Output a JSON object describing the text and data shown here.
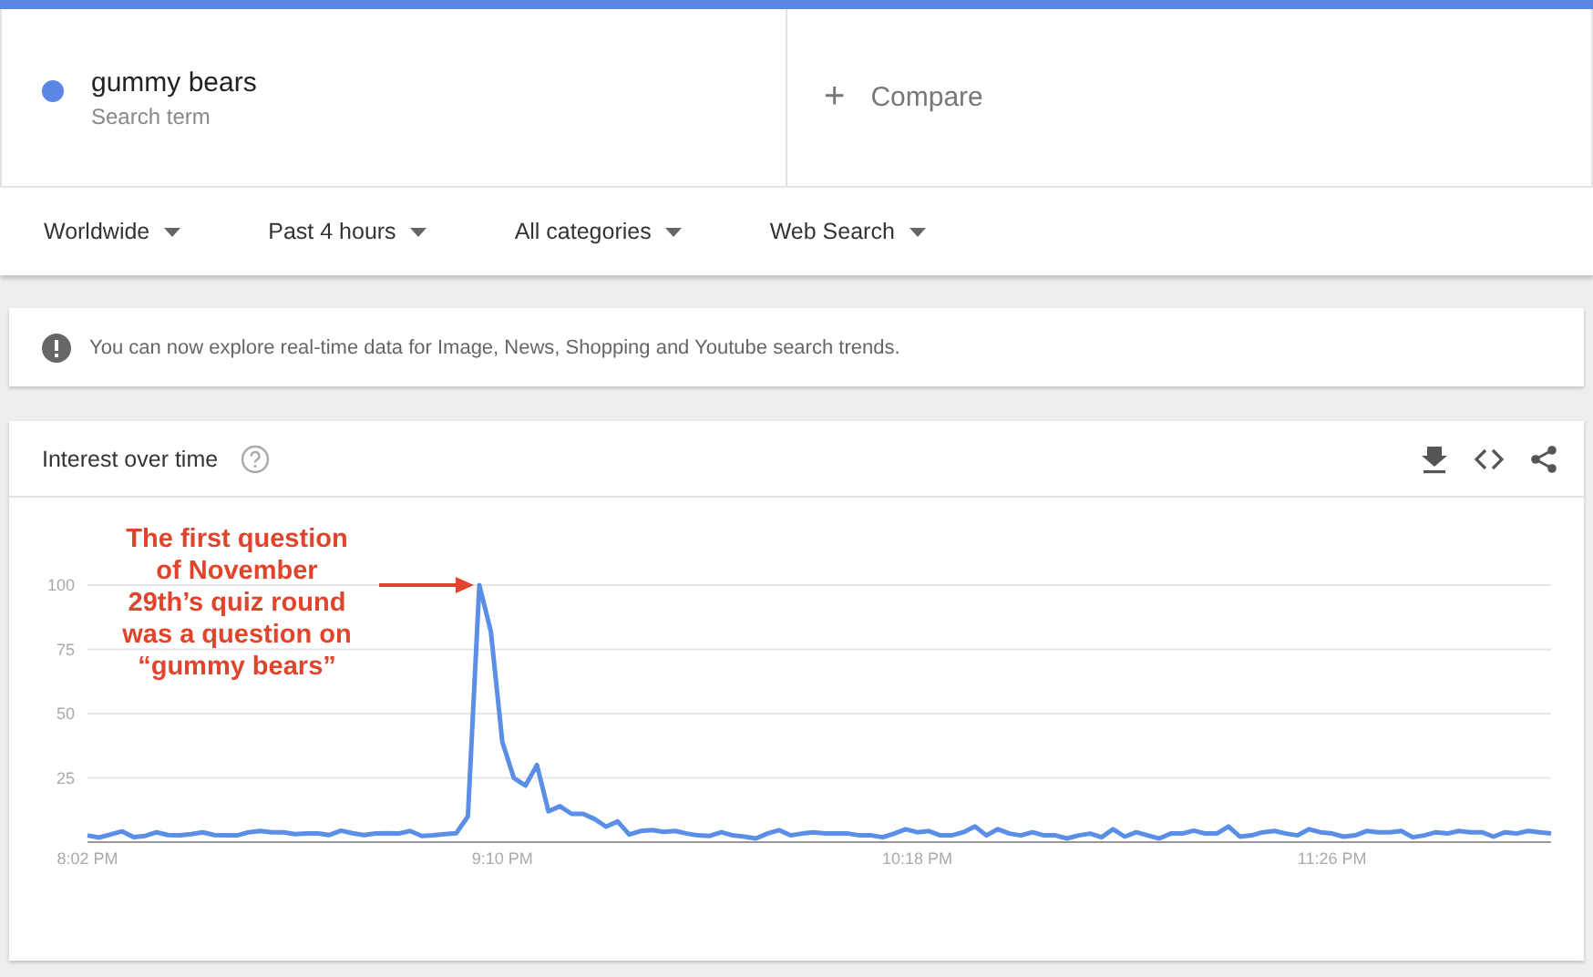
{
  "terms": [
    {
      "label": "gummy bears",
      "sublabel": "Search term",
      "color": "#5b86e5"
    }
  ],
  "compare": {
    "label": "Compare",
    "icon": "+"
  },
  "filters": [
    {
      "label": "Worldwide"
    },
    {
      "label": "Past 4 hours"
    },
    {
      "label": "All categories"
    },
    {
      "label": "Web Search"
    }
  ],
  "notice": {
    "text": "You can now explore real-time data for Image, News, Shopping and Youtube search trends."
  },
  "interest_panel": {
    "title": "Interest over time",
    "chart_data": {
      "type": "line",
      "grid": true,
      "ylim": [
        0,
        100
      ],
      "yticks": [
        25,
        50,
        75,
        100
      ],
      "categories": [
        "8:02 PM",
        null,
        null,
        null,
        null,
        null,
        null,
        null,
        null,
        null,
        null,
        null,
        null,
        null,
        null,
        null,
        null,
        null,
        null,
        null,
        null,
        null,
        null,
        null,
        null,
        null,
        null,
        null,
        null,
        null,
        null,
        null,
        null,
        null,
        null,
        null,
        "9:10 PM",
        null,
        null,
        null,
        null,
        null,
        null,
        null,
        null,
        null,
        null,
        null,
        null,
        null,
        null,
        null,
        null,
        null,
        null,
        null,
        null,
        null,
        null,
        null,
        null,
        null,
        null,
        null,
        null,
        null,
        null,
        null,
        null,
        null,
        null,
        null,
        "10:18 PM",
        null,
        null,
        null,
        null,
        null,
        null,
        null,
        null,
        null,
        null,
        null,
        null,
        null,
        null,
        null,
        null,
        null,
        null,
        null,
        null,
        null,
        null,
        null,
        null,
        null,
        null,
        null,
        null,
        null,
        null,
        null,
        null,
        null,
        null,
        null,
        "11:26 PM",
        null,
        null,
        null,
        null,
        null,
        null,
        null,
        null,
        null,
        null,
        null,
        null,
        null,
        null,
        null,
        null,
        null,
        null,
        null
      ],
      "series": [
        {
          "color": "#5b8ee6",
          "values": [
            2.6,
            1.8,
            3.0,
            4.2,
            1.9,
            2.4,
            3.8,
            2.8,
            2.6,
            3.1,
            3.8,
            2.8,
            2.6,
            2.6,
            3.8,
            4.3,
            3.8,
            3.8,
            3.1,
            3.3,
            3.3,
            2.8,
            4.5,
            3.5,
            2.8,
            3.3,
            3.5,
            3.3,
            4.3,
            2.4,
            2.6,
            3.1,
            3.5,
            10,
            100,
            82,
            39,
            25,
            22,
            30,
            12,
            14,
            11,
            11,
            9,
            6,
            8,
            3,
            4.3,
            4.7,
            4.0,
            4.3,
            3.3,
            2.6,
            2.4,
            3.8,
            2.6,
            2.1,
            1.4,
            3.3,
            4.7,
            2.6,
            3.3,
            3.8,
            3.3,
            3.3,
            3.3,
            2.6,
            2.6,
            1.9,
            3.3,
            5.0,
            3.8,
            4.3,
            2.6,
            2.6,
            3.8,
            6.1,
            2.6,
            5.0,
            3.3,
            2.6,
            3.8,
            2.6,
            2.6,
            1.4,
            2.6,
            3.3,
            1.9,
            5.0,
            2.1,
            3.8,
            2.6,
            1.4,
            3.3,
            3.3,
            4.5,
            3.3,
            3.3,
            6.1,
            2.1,
            2.6,
            3.8,
            4.3,
            3.3,
            2.6,
            5.0,
            3.8,
            3.3,
            2.1,
            2.6,
            4.3,
            3.8,
            3.8,
            4.3,
            1.9,
            2.6,
            3.8,
            3.3,
            4.3,
            3.8,
            3.8,
            2.1,
            3.8,
            3.3,
            4.3,
            3.8,
            3.3
          ]
        }
      ],
      "annotations": [
        {
          "text": "The first question\nof November\n29th’s quiz round\nwas a question on\n“gummy bears”"
        }
      ]
    }
  }
}
